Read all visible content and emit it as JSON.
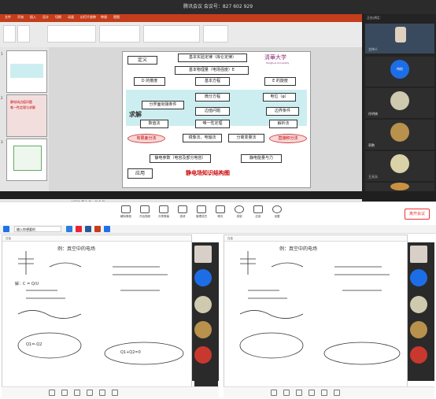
{
  "top_window": {
    "title": "腾讯会议  会议号：827 602 929",
    "ppt": {
      "tabs": [
        "文件",
        "开始",
        "插入",
        "设计",
        "切换",
        "动画",
        "幻灯片放映",
        "审阅",
        "视图"
      ],
      "status": "幻灯片 第 1 张，共 6 张",
      "thumb_numbers": [
        "1",
        "2",
        "3"
      ],
      "thumb_text": [
        "静电场边值问题",
        "唯一性定理与求解"
      ],
      "slide": {
        "logo": "清華大学",
        "logo_sub": "Tsinghua University",
        "title": "静电场知识结构图",
        "boxes": {
          "definition": "定义",
          "basic_law": "基本实验定律（库仑定律）",
          "basic_quantity": "基本物理量（电场强度）E",
          "d_divergence": "D 的散度",
          "equation": "基本方程",
          "e_curl": "E 的旋度",
          "differential": "微分方程",
          "potential": "电位（φ）",
          "interface": "分界面衔接条件",
          "bvp": "边值问题",
          "boundary": "边界条件",
          "solve": "求解",
          "numerical": "数值法",
          "uniqueness": "唯一性定理",
          "analytic": "解析法",
          "finite_diff": "有限差分法",
          "image_method": "镜像法、电轴法",
          "separation": "分离变量法",
          "integral": "直接积分法",
          "application": "应用",
          "capacitance": "静电参数（电容及部分电容）",
          "energy": "静电能量与力"
        }
      }
    },
    "participants": {
      "header": "正在讲话：",
      "names": [
        "主持人",
        "待检",
        "徐明楠",
        "郭鹏",
        "王天乐",
        ""
      ]
    },
    "toolbar": {
      "items": [
        "解除静音",
        "开启视频",
        "共享屏幕",
        "邀请",
        "管理成员",
        "聊天",
        "录制",
        "应用",
        "设置"
      ],
      "end_label": "离开会议"
    }
  },
  "bottom": {
    "search_placeholder": "输入你想要的",
    "left_board": {
      "header": "白板",
      "lines": [
        "例：真空中的电场",
        "解：C = Q/U",
        "Q1=-Q2",
        "Q1+Q2=0"
      ]
    },
    "right_board": {
      "header": "白板",
      "lines": [
        "例：真空中的电场"
      ]
    }
  }
}
